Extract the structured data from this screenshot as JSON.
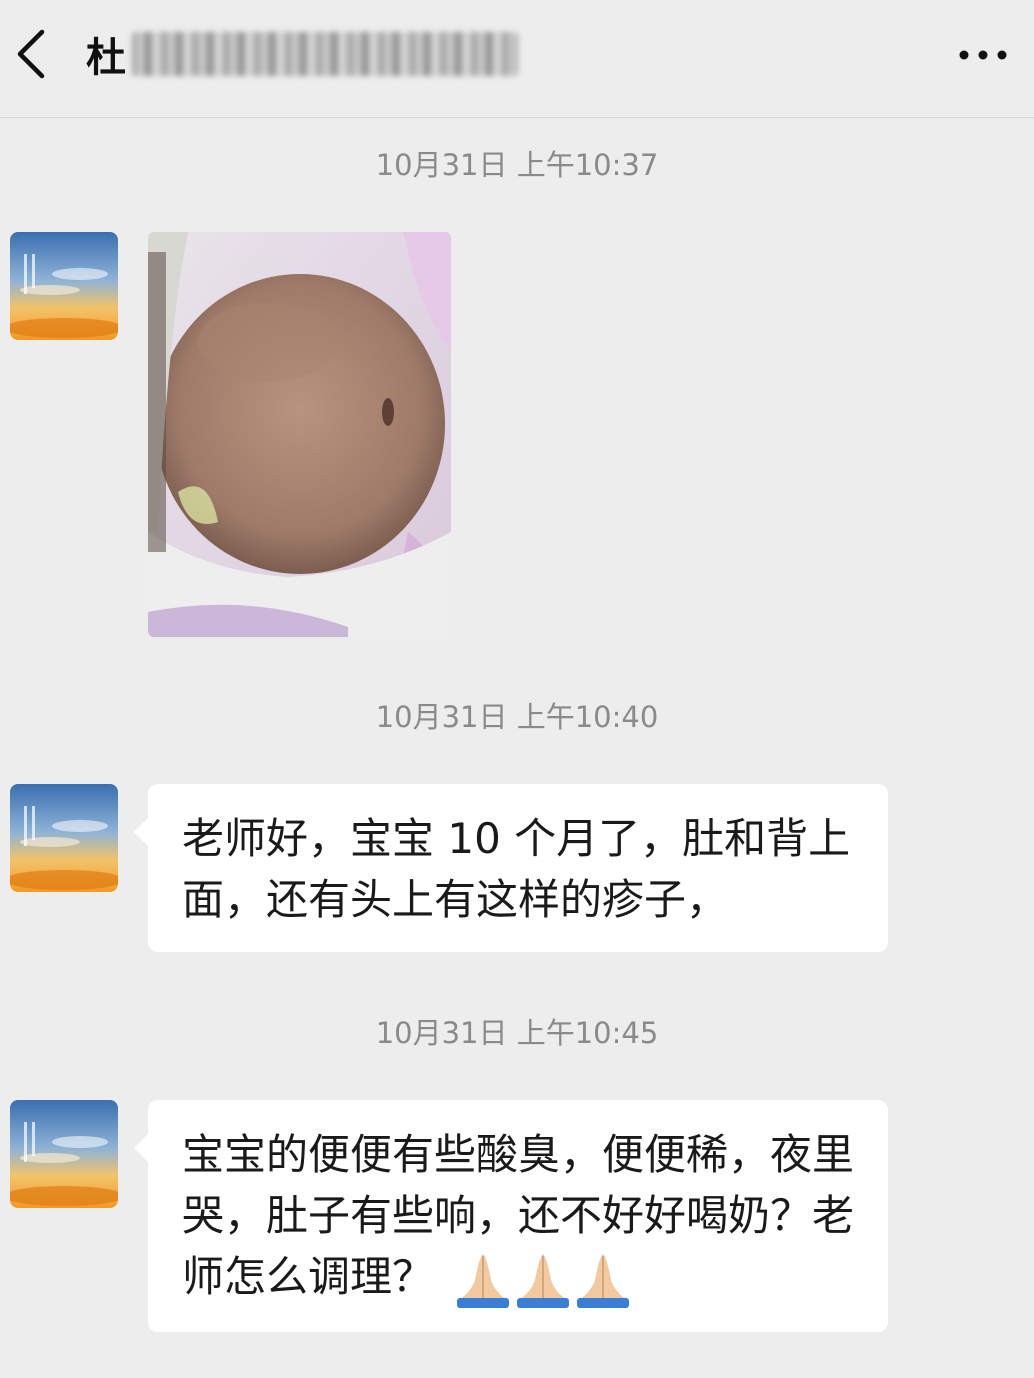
{
  "header": {
    "title": "杜",
    "back_icon": "chevron-left-icon",
    "more_icon": "more-dots-icon"
  },
  "messages": [
    {
      "timestamp": "10月31日 上午10:37",
      "type": "image"
    },
    {
      "timestamp": "10月31日 上午10:40",
      "type": "text",
      "text": "老师好，宝宝 10 个月了，肚和背上面，还有头上有这样的疹子，"
    },
    {
      "timestamp": "10月31日 上午10:45",
      "type": "text",
      "text": "宝宝的便便有些酸臭，便便稀，夜里哭，肚子有些响，还不好好喝奶？老师怎么调理？",
      "emoji": [
        "pray-icon",
        "pray-icon",
        "pray-icon"
      ]
    }
  ],
  "colors": {
    "background": "#ededed",
    "bubble": "#ffffff",
    "timestamp": "#8a8a8a",
    "text": "#1a1a1a"
  }
}
